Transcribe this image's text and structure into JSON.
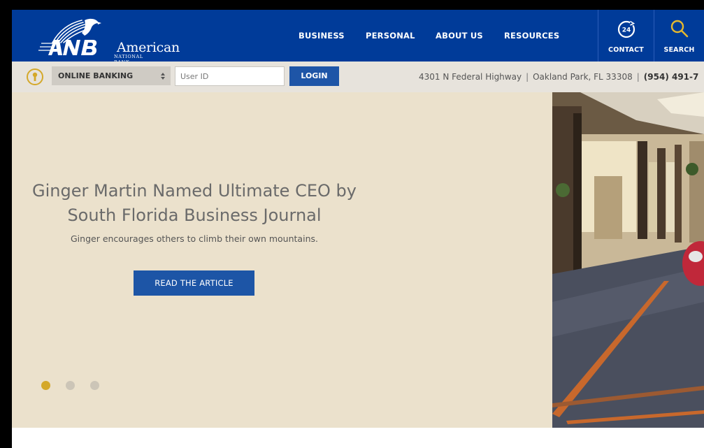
{
  "logo": {
    "mark": "ANB",
    "name": "American",
    "subtitle": "NATIONAL BANK"
  },
  "nav": {
    "items": [
      {
        "label": "BUSINESS"
      },
      {
        "label": "PERSONAL"
      },
      {
        "label": "ABOUT US"
      },
      {
        "label": "RESOURCES"
      }
    ]
  },
  "utility": {
    "contact": {
      "label": "CONTACT",
      "icon": "24-hour-clock-icon",
      "badge": "24"
    },
    "search": {
      "label": "SEARCH",
      "icon": "search-icon"
    }
  },
  "banking": {
    "icon": "key-icon",
    "select_value": "ONLINE BANKING",
    "userid_placeholder": "User ID",
    "login_label": "LOGIN",
    "address": "4301 N Federal Highway",
    "city": "Oakland Park, FL 33308",
    "separator": "|",
    "phone": "(954) 491-7"
  },
  "hero": {
    "title_line1": "Ginger Martin Named Ultimate CEO by",
    "title_line2": "South Florida Business Journal",
    "subtitle": "Ginger encourages others to climb their own mountains.",
    "button_label": "READ THE ARTICLE",
    "slides": {
      "count": 3,
      "active": 1
    }
  },
  "colors": {
    "header_bg": "#003b99",
    "bankbar_bg": "#e7e3dc",
    "hero_bg": "#ebe1cc",
    "button_blue": "#1d55a6",
    "accent_gold": "#d4a82a"
  }
}
